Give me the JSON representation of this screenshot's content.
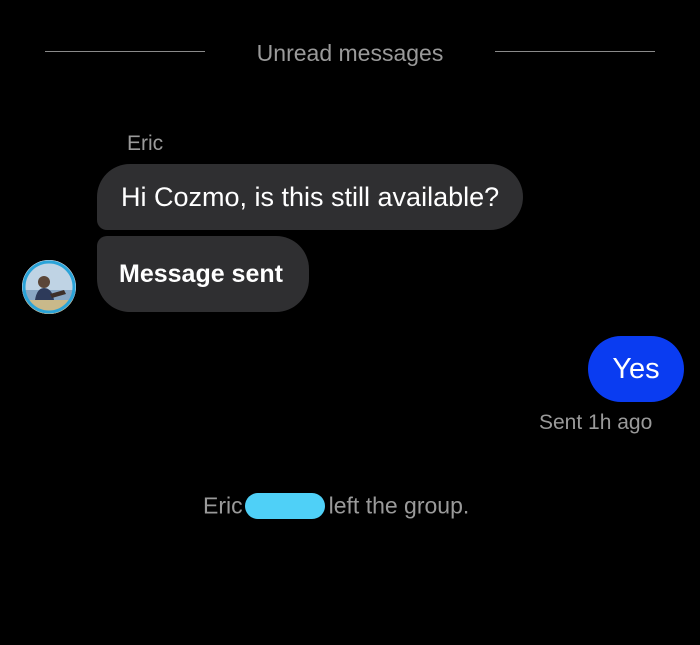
{
  "divider": {
    "label": "Unread messages"
  },
  "incoming": {
    "sender_name": "Eric",
    "messages": [
      {
        "text": "Hi Cozmo, is this still available?"
      },
      {
        "text": "Message sent"
      }
    ],
    "avatar_icon": "user-avatar-photo"
  },
  "outgoing": {
    "text": "Yes",
    "status": "Sent 1h ago",
    "bubble_color": "#0a3cf1"
  },
  "system": {
    "name": "Eric",
    "redaction_color": "#4fd0f7",
    "text": "left the group."
  },
  "colors": {
    "background": "#000000",
    "incoming_bubble": "#2f2f31",
    "muted_text": "#9a9a9a"
  }
}
